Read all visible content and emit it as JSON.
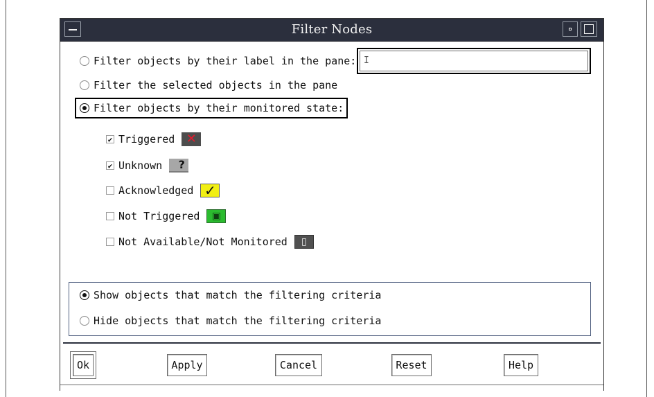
{
  "dialog": {
    "title": "Filter Nodes"
  },
  "filter_options": [
    {
      "label": "Filter objects by their label in the pane:",
      "selected": false
    },
    {
      "label": "Filter the selected objects in the pane",
      "selected": false
    },
    {
      "label": "Filter objects by their monitored state:",
      "selected": true
    }
  ],
  "label_filter": {
    "value": "",
    "placeholder": ""
  },
  "states": [
    {
      "label": "Triggered",
      "checked": true,
      "icon": "triggered-state-icon"
    },
    {
      "label": "Unknown",
      "checked": true,
      "icon": "unknown-state-icon"
    },
    {
      "label": "Acknowledged",
      "checked": false,
      "icon": "acknowledged-state-icon"
    },
    {
      "label": "Not Triggered",
      "checked": false,
      "icon": "not-triggered-state-icon"
    },
    {
      "label": "Not Available/Not Monitored",
      "checked": false,
      "icon": "not-available-state-icon"
    }
  ],
  "match_options": [
    {
      "label": "Show objects that match the filtering criteria",
      "selected": true
    },
    {
      "label": "Hide objects that match the filtering criteria",
      "selected": false
    }
  ],
  "buttons": {
    "ok": "Ok",
    "apply": "Apply",
    "cancel": "Cancel",
    "reset": "Reset",
    "help": "Help"
  },
  "colors": {
    "titlebar": "#2b2f3d",
    "group_border": "#4f5f7f",
    "triggered": "#e31b2d",
    "acknowledged": "#f1ef13",
    "not_triggered": "#2bbb2f",
    "not_available": "#505050"
  }
}
